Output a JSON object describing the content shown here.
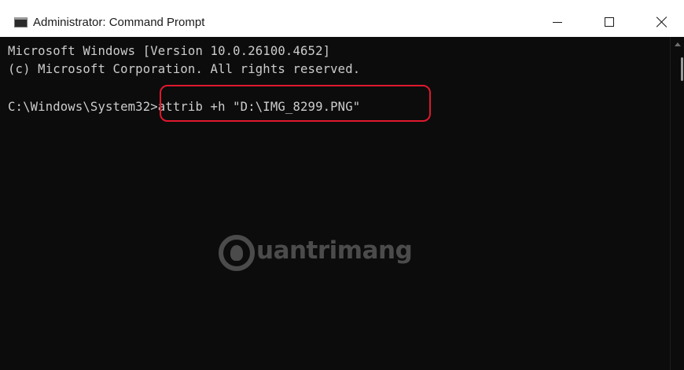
{
  "window": {
    "title": "Administrator: Command Prompt",
    "icon": "command-prompt-icon",
    "controls": {
      "minimize": "minimize-icon",
      "maximize": "maximize-icon",
      "close": "close-icon"
    }
  },
  "console": {
    "lines": [
      "Microsoft Windows [Version 10.0.26100.4652]",
      "(c) Microsoft Corporation. All rights reserved.",
      "C:\\Windows\\System32>attrib +h \"D:\\IMG_8299.PNG\""
    ],
    "highlight_color": "#e0182d",
    "text_color": "#cccccc",
    "background_color": "#0c0c0c"
  },
  "watermark": {
    "text": "uantrimang"
  }
}
